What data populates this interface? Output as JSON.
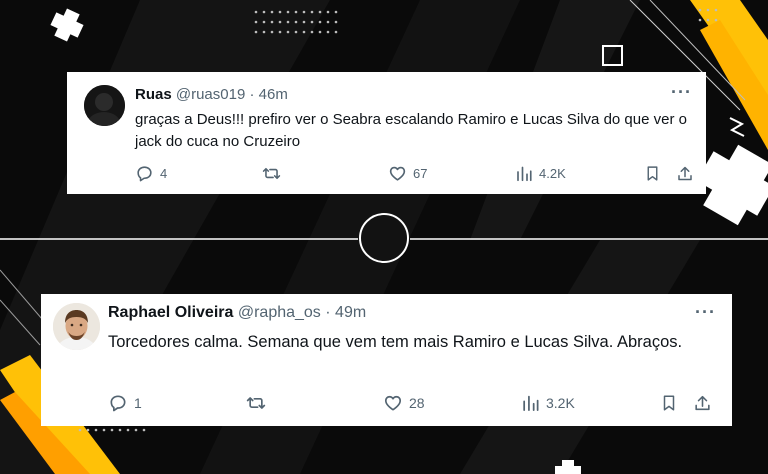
{
  "tweets": [
    {
      "name": "Ruas",
      "handle": "@ruas019",
      "separator": "·",
      "time": "46m",
      "more": "···",
      "text": "graças a Deus!!! prefiro ver o Seabra escalando Ramiro e Lucas Silva do que ver o jack do cuca no Cruzeiro",
      "replies": "4",
      "likes": "67",
      "views": "4.2K"
    },
    {
      "name": "Raphael Oliveira",
      "handle": "@rapha_os",
      "separator": "·",
      "time": "49m",
      "more": "···",
      "text": "Torcedores calma. Semana que vem tem mais Ramiro e Lucas Silva. Abraços.",
      "replies": "1",
      "likes": "28",
      "views": "3.2K"
    }
  ],
  "icons": [
    "reply-icon",
    "retweet-icon",
    "like-icon",
    "views-icon",
    "bookmark-icon",
    "share-icon"
  ],
  "colors": {
    "background": "#0b0b0b",
    "accent_yellow": "#ffc107",
    "text_primary": "#0f1419",
    "text_secondary": "#536471"
  }
}
